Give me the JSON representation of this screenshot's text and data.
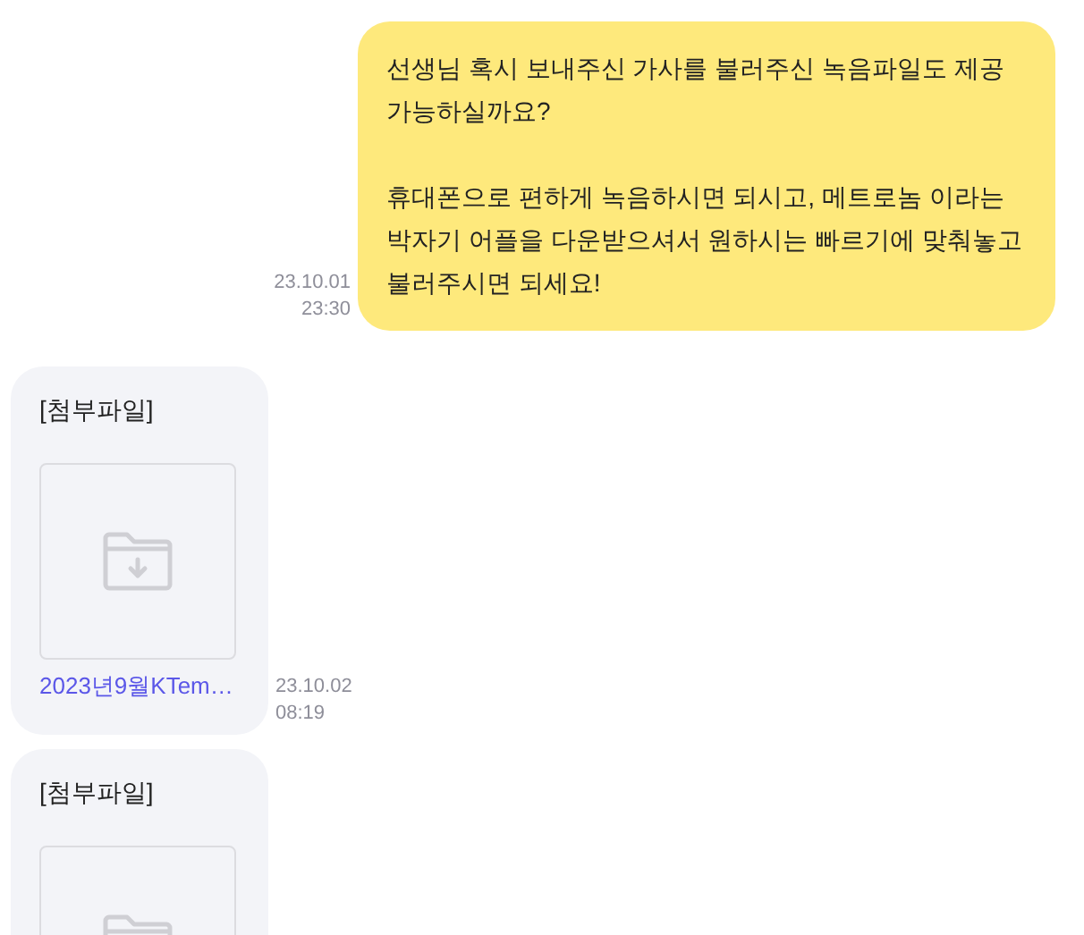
{
  "messages": [
    {
      "kind": "text",
      "paragraphs": [
        "선생님 혹시 보내주신 가사를 불러주신 녹음파일도 제공 가능하실까요?",
        "휴대폰으로 편하게 녹음하시면 되시고, 메트로놈 이라는 박자기 어플을 다운받으셔서 원하시는 빠르기에 맞춰놓고 불러주시면 되세요!"
      ],
      "date": "23.10.01",
      "time": "23:30"
    },
    {
      "kind": "file",
      "label": "[첨부파일]",
      "filename": "2023년9월KTem…",
      "date": "23.10.02",
      "time": "08:19"
    },
    {
      "kind": "file",
      "label": "[첨부파일]"
    }
  ]
}
